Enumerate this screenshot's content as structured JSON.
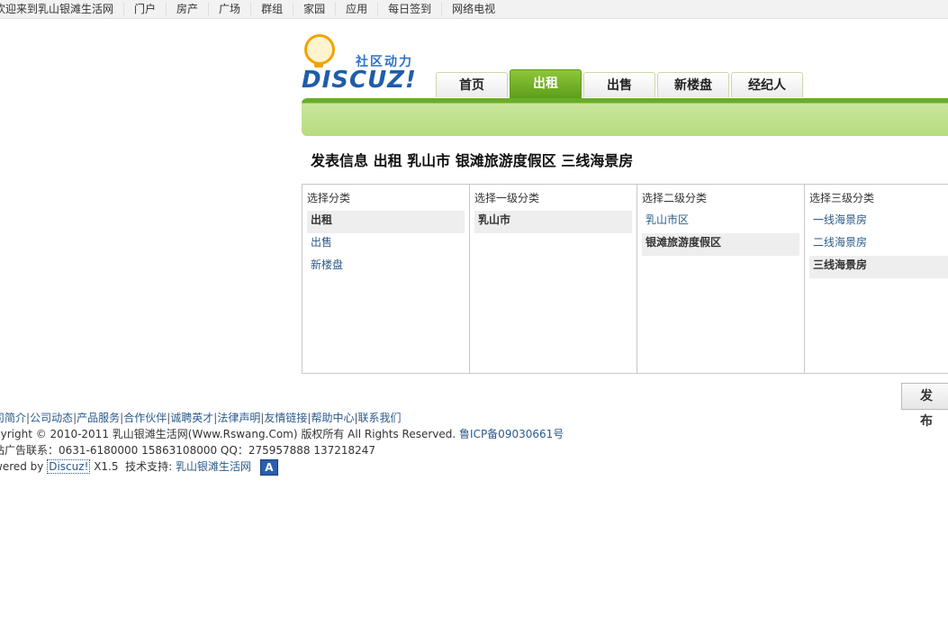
{
  "topbar": {
    "items": [
      "欢迎来到乳山银滩生活网",
      "门户",
      "房产",
      "广场",
      "群组",
      "家园",
      "应用",
      "每日签到",
      "网络电视"
    ]
  },
  "logo": {
    "tagline": "社区动力",
    "brand": "DISCUZ!"
  },
  "nav": {
    "tabs": [
      "首页",
      "出租",
      "出售",
      "新楼盘",
      "经纪人"
    ],
    "active_index": 1
  },
  "heading": "发表信息 出租 乳山市 银滩旅游度假区 三线海景房",
  "selector": {
    "columns": [
      {
        "title": "选择分类",
        "options": [
          "出租",
          "出售",
          "新楼盘"
        ],
        "selected": 0
      },
      {
        "title": "选择一级分类",
        "options": [
          "乳山市"
        ],
        "selected": 0
      },
      {
        "title": "选择二级分类",
        "options": [
          "乳山市区",
          "银滩旅游度假区"
        ],
        "selected": 1
      },
      {
        "title": "选择三级分类",
        "options": [
          "一线海景房",
          "二线海景房",
          "三线海景房"
        ],
        "selected": 2
      }
    ]
  },
  "publish_button": "发 布",
  "footer": {
    "links": [
      "司简介",
      "公司动态",
      "产品服务",
      "合作伙伴",
      "诚聘英才",
      "法律声明",
      "友情链接",
      "帮助中心",
      "联系我们"
    ],
    "copyright_prefix": "pyright © 2010-2011 乳山银滩生活网(Www.Rswang.Com) 版权所有 All Rights Reserved.",
    "icp": "鲁ICP备09030661号",
    "contact": "站广告联系：0631-6180000 15863108000 QQ：275957888 137218247",
    "powered_prefix": "wered by",
    "powered_link": "Discuz!",
    "version": "X1.5",
    "support_label": "技术支持:",
    "support_link": "乳山银滩生活网",
    "badge": "A"
  },
  "colors": {
    "nav_active": "#6aad28",
    "link": "#2a5a8a",
    "brand": "#1e5ea8"
  }
}
